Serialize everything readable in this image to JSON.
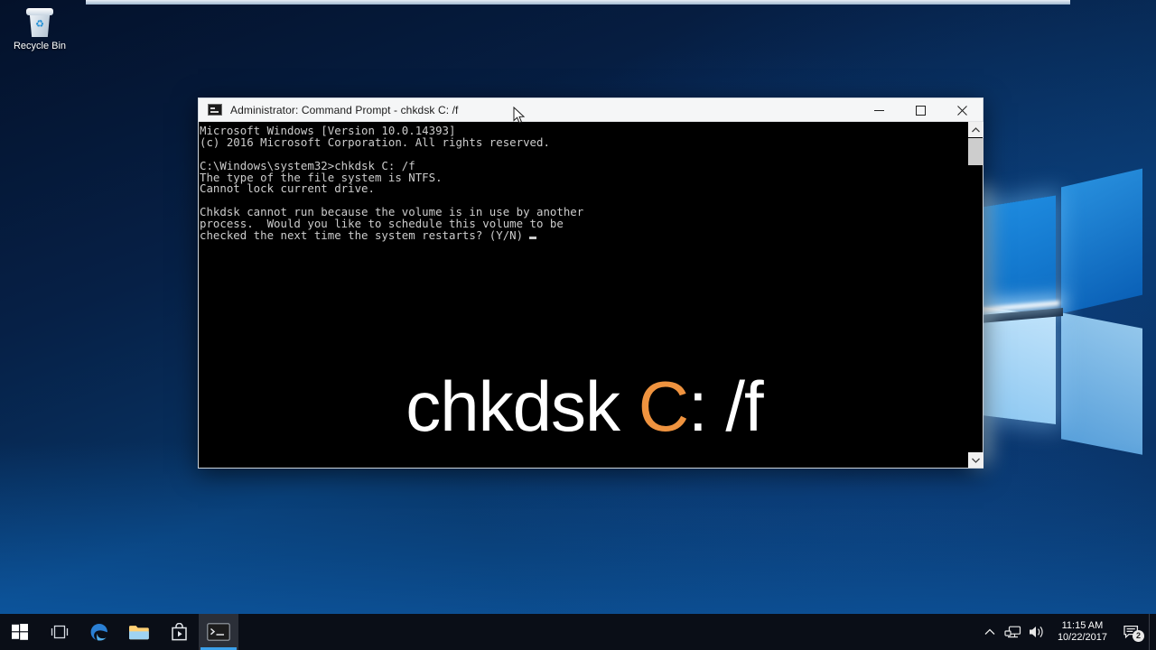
{
  "desktop": {
    "icons": [
      {
        "name": "Recycle Bin",
        "icon": "recycle-bin-icon"
      }
    ]
  },
  "window": {
    "title": "Administrator: Command Prompt - chkdsk  C: /f",
    "icon": "command-prompt-icon",
    "controls": {
      "minimize": "Minimize",
      "maximize": "Maximize",
      "close": "Close"
    },
    "console": {
      "lines": [
        "Microsoft Windows [Version 10.0.14393]",
        "(c) 2016 Microsoft Corporation. All rights reserved.",
        "",
        "C:\\Windows\\system32>chkdsk C: /f",
        "The type of the file system is NTFS.",
        "Cannot lock current drive.",
        "",
        "Chkdsk cannot run because the volume is in use by another",
        "process.  Would you like to schedule this volume to be",
        "checked the next time the system restarts? (Y/N)"
      ],
      "cursor": "_"
    },
    "overlay": {
      "command": "chkdsk ",
      "drive": "C",
      "suffix": ": /f",
      "drive_color": "#ef933f",
      "text_color": "#ffffff"
    },
    "scrollbar": {
      "up": "scroll-up-arrow",
      "down": "scroll-down-arrow"
    }
  },
  "taskbar": {
    "buttons": [
      {
        "name": "start-button",
        "label": "Start"
      },
      {
        "name": "task-view-button",
        "label": "Task View"
      },
      {
        "name": "edge-button",
        "label": "Microsoft Edge"
      },
      {
        "name": "file-explorer-button",
        "label": "File Explorer"
      },
      {
        "name": "store-button",
        "label": "Microsoft Store"
      },
      {
        "name": "command-prompt-button",
        "label": "Command Prompt",
        "active": true
      }
    ],
    "tray": {
      "chevron": "show-hidden-icons",
      "network": "network-icon",
      "volume": "volume-icon",
      "time": "11:15 AM",
      "date": "10/22/2017",
      "notifications": "action-center-icon",
      "notification_count": "2"
    }
  }
}
